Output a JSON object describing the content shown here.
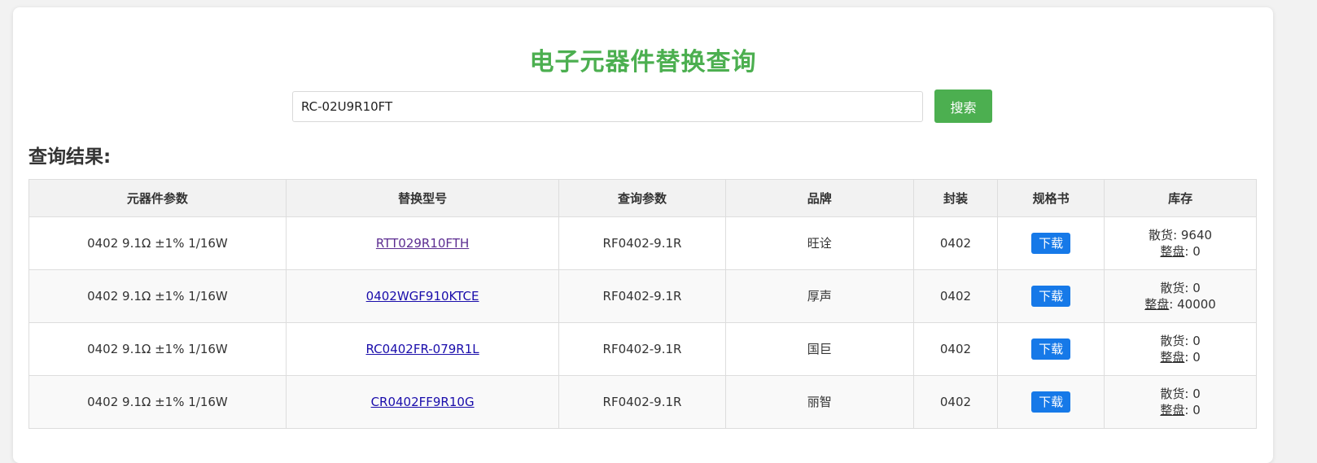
{
  "page": {
    "title": "电子元器件替换查询",
    "accent_color": "#4CAF50",
    "download_color": "#1679e8"
  },
  "search": {
    "value": "RC-02U9R10FT",
    "button_label": "搜索"
  },
  "results": {
    "heading": "查询结果:",
    "columns": [
      "元器件参数",
      "替换型号",
      "查询参数",
      "品牌",
      "封装",
      "规格书",
      "库存"
    ],
    "rows": [
      {
        "param": "0402 9.1Ω ±1% 1/16W",
        "model": "RTT029R10FTH",
        "query": "RF0402-9.1R",
        "brand": "旺诠",
        "package": "0402",
        "datasheet": "下载",
        "loose_label": "散货",
        "loose_value": "9640",
        "reel_label": "整盘",
        "reel_value": "0"
      },
      {
        "param": "0402 9.1Ω ±1% 1/16W",
        "model": "0402WGF910KTCE",
        "query": "RF0402-9.1R",
        "brand": "厚声",
        "package": "0402",
        "datasheet": "下载",
        "loose_label": "散货",
        "loose_value": "0",
        "reel_label": "整盘",
        "reel_value": "40000"
      },
      {
        "param": "0402 9.1Ω ±1% 1/16W",
        "model": "RC0402FR-079R1L",
        "query": "RF0402-9.1R",
        "brand": "国巨",
        "package": "0402",
        "datasheet": "下载",
        "loose_label": "散货",
        "loose_value": "0",
        "reel_label": "整盘",
        "reel_value": "0"
      },
      {
        "param": "0402 9.1Ω ±1% 1/16W",
        "model": "CR0402FF9R10G",
        "query": "RF0402-9.1R",
        "brand": "丽智",
        "package": "0402",
        "datasheet": "下载",
        "loose_label": "散货",
        "loose_value": "0",
        "reel_label": "整盘",
        "reel_value": "0"
      }
    ]
  }
}
